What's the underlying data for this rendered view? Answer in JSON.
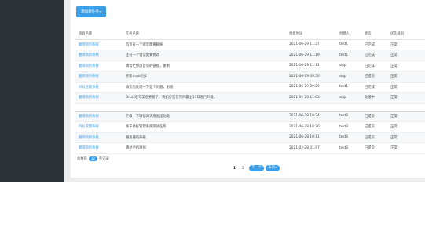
{
  "toolbar": {
    "add_label": "添加新任务",
    "caret": "▾"
  },
  "table": {
    "headers": [
      "项目名称",
      "任务名称",
      "创建时间",
      "创建人",
      "状态",
      "优先级别"
    ],
    "rows": [
      [
        "翻牌项目系统",
        "首页有一个提示需要删掉",
        "2021-06-29 11:27",
        "test1",
        "已完成",
        "正常"
      ],
      [
        "翻牌项目系统",
        "还有一个错误需要修改",
        "2021-06-29 11:19",
        "test1",
        "已完成",
        "正常"
      ],
      [
        "翻牌项目系统",
        "请帮忙修改首页的链接，谢谢",
        "2021-06-29 11:11",
        "skip",
        "已完成",
        "正常"
      ],
      [
        "翻牌项目系统",
        "更新druid包2",
        "2021-06-29 09:50",
        "skip",
        "已提交",
        "正常"
      ],
      [
        "目标管理系统",
        "请优先处理一下这个问题，谢谢",
        "2021-06-29 09:29",
        "test1",
        "已完成",
        "正常"
      ],
      [
        "翻牌项目系统",
        "Druid发布安全更新了，我们分别在项目最上10日进行升级。",
        "2021-06-28 11:03",
        "skip",
        "处理中",
        "正常"
      ],
      [
        "翻牌项目系统",
        "升级一下微信的消息发送功能",
        "2021-06-28 10:24",
        "test3",
        "已提交",
        "正常"
      ],
      [
        "目标管理系统",
        "关于目标管理系统测试任务",
        "2021-06-28 10:20",
        "test3",
        "已提交",
        "正常"
      ],
      [
        "翻牌项目系统",
        "服务器的升级",
        "2021-06-28 10:11",
        "test3",
        "已提交",
        "正常"
      ],
      [
        "翻牌项目系统",
        "请过手机添加",
        "2021-02-28 01:47",
        "test3",
        "已提交",
        "正常"
      ]
    ]
  },
  "summary": {
    "prefix": "总共有",
    "count": "12",
    "suffix": "条记录"
  },
  "pagination": {
    "pages": [
      "1",
      "2"
    ],
    "current": "1",
    "next_label": "下一个",
    "last_label": "末页»"
  }
}
